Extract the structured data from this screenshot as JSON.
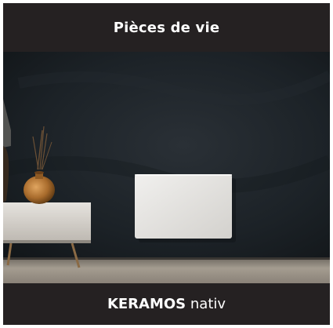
{
  "header": {
    "title": "Pièces de vie"
  },
  "product": {
    "brand": "KERAMOS",
    "model": "nativ"
  },
  "colors": {
    "band": "#252122",
    "wall": "#1d2328",
    "floor": "#a29a8e",
    "panel": "#e8e6e3",
    "sideboard": "#d9d5d0",
    "vase": "#b47a3a"
  }
}
